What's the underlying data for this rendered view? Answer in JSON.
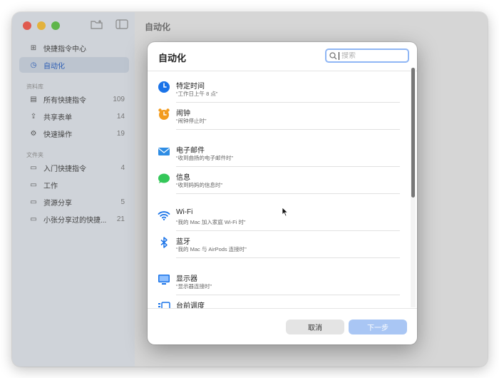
{
  "window": {
    "content_title": "自动化"
  },
  "sidebar": {
    "top_items": [
      {
        "label": "快捷指令中心",
        "icon": "grid-icon"
      },
      {
        "label": "自动化",
        "icon": "clock-icon",
        "selected": true
      }
    ],
    "library_header": "资料库",
    "library_items": [
      {
        "label": "所有快捷指令",
        "count": "109"
      },
      {
        "label": "共享表单",
        "count": "14"
      },
      {
        "label": "快速操作",
        "count": "19"
      }
    ],
    "folders_header": "文件夹",
    "folder_items": [
      {
        "label": "入门快捷指令",
        "count": "4"
      },
      {
        "label": "工作",
        "count": ""
      },
      {
        "label": "资源分享",
        "count": "5"
      },
      {
        "label": "小张分享过的快捷...",
        "count": "21"
      }
    ]
  },
  "dialog": {
    "title": "自动化",
    "search_placeholder": "搜索",
    "triggers": [
      {
        "title": "特定时间",
        "subtitle": "“工作日上午 8 点”",
        "icon": "clock-icon",
        "color": "#1a73e8"
      },
      {
        "title": "闹钟",
        "subtitle": "“闹钟停止时”",
        "icon": "alarm-icon",
        "color": "#f39c1e"
      },
      {
        "title": "电子邮件",
        "subtitle": "“收到曲扬的电子邮件时”",
        "icon": "mail-icon",
        "color": "#2f8de4"
      },
      {
        "title": "信息",
        "subtitle": "“收到妈妈的信息时”",
        "icon": "message-icon",
        "color": "#34c759"
      },
      {
        "title": "Wi-Fi",
        "subtitle": "“我的 Mac 加入家庭 Wi-Fi 时”",
        "icon": "wifi-icon",
        "color": "#1a73e8"
      },
      {
        "title": "蓝牙",
        "subtitle": "“我的 Mac 与 AirPods 连接时”",
        "icon": "bluetooth-icon",
        "color": "#1a73e8"
      },
      {
        "title": "显示器",
        "subtitle": "“显示器连接时”",
        "icon": "display-icon",
        "color": "#1a73e8"
      },
      {
        "title": "台前调度",
        "subtitle": "",
        "icon": "stage-manager-icon",
        "color": "#1a73e8"
      }
    ],
    "cancel_label": "取消",
    "next_label": "下一步"
  },
  "colors": {
    "accent": "#1a73e8",
    "traffic_close": "#e05a4f",
    "traffic_min": "#e3b23c",
    "traffic_max": "#5fb54a"
  }
}
